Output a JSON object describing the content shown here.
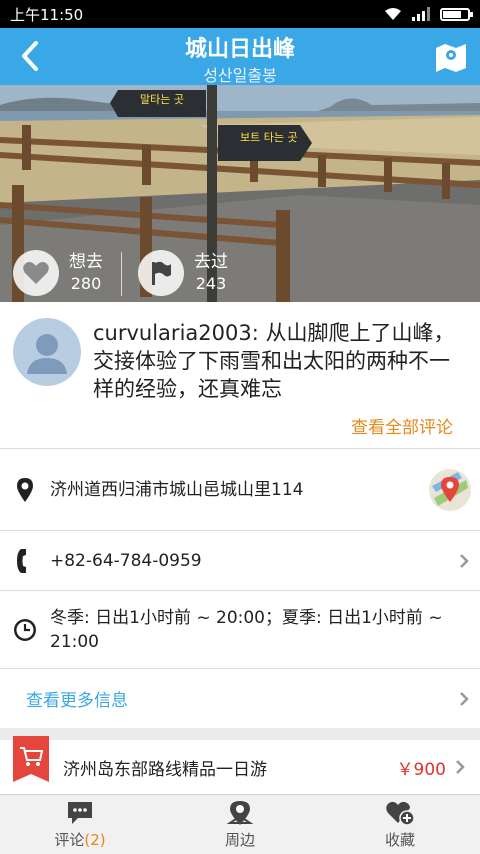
{
  "status_bar": {
    "time": "上午11:50"
  },
  "header": {
    "title": "城山日出峰",
    "subtitle": "성산일출봉"
  },
  "hero": {
    "sign_top": "말타는 곳",
    "sign_bottom": "보트 타는 곳",
    "want": {
      "label": "想去",
      "count": "280"
    },
    "been": {
      "label": "去过",
      "count": "243"
    }
  },
  "review": {
    "text": "curvularia2003: 从山脚爬上了山峰，交接体验了下雨雪和出太阳的两种不一样的经验，还真难忘",
    "see_all": "查看全部评论"
  },
  "info": {
    "address": "济州道西归浦市城山邑城山里114",
    "phone": "+82-64-784-0959",
    "hours": "冬季: 日出1小时前 ~ 20:00；夏季: 日出1小时前 ~ 21:00",
    "more": "查看更多信息"
  },
  "product": {
    "name": "济州岛东部路线精品一日游",
    "price": "￥900"
  },
  "tabs": {
    "comments": {
      "label": "评论",
      "count": "(2)"
    },
    "nearby": {
      "label": "周边"
    },
    "favorite": {
      "label": "收藏"
    }
  },
  "colors": {
    "header_blue": "#3aa8e6",
    "accent_orange": "#e58a17",
    "price_red": "#e0322b"
  }
}
